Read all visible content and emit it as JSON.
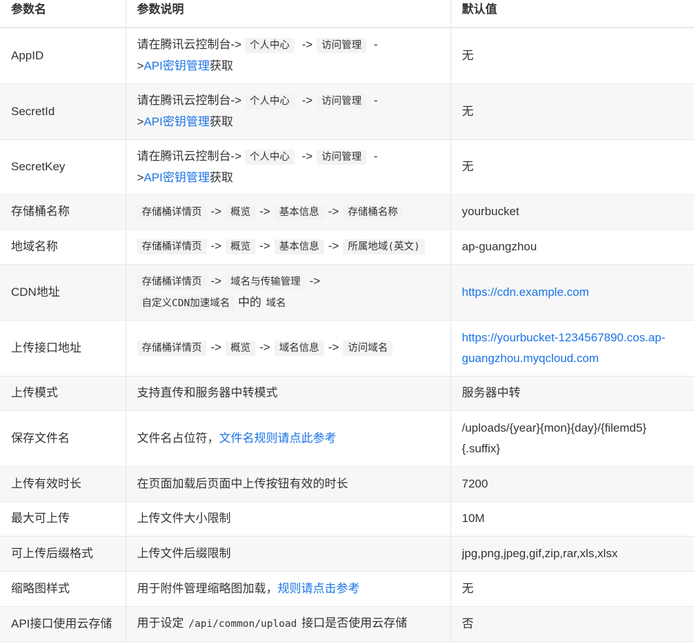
{
  "headers": [
    "参数名",
    "参数说明",
    "默认值"
  ],
  "rows": {
    "appid": {
      "name": "AppID",
      "desc": {
        "prefix": "请在腾讯云控制台->",
        "crumbs": [
          "个人中心",
          "访问管理"
        ],
        "arrow": "->",
        "tail_dash": "-",
        "tail_gt": ">",
        "link": "API密钥管理",
        "suffix": "获取"
      },
      "default": "无"
    },
    "secretid": {
      "name": "SecretId",
      "desc": {
        "prefix": "请在腾讯云控制台->",
        "crumbs": [
          "个人中心",
          "访问管理"
        ],
        "arrow": "->",
        "tail_dash": "-",
        "tail_gt": ">",
        "link": "API密钥管理",
        "suffix": "获取"
      },
      "default": "无"
    },
    "secretkey": {
      "name": "SecretKey",
      "desc": {
        "prefix": "请在腾讯云控制台->",
        "crumbs": [
          "个人中心",
          "访问管理"
        ],
        "arrow": "->",
        "tail_dash": "-",
        "tail_gt": ">",
        "link": "API密钥管理",
        "suffix": "获取"
      },
      "default": "无"
    },
    "bucket": {
      "name": "存储桶名称",
      "desc": {
        "crumbs": [
          "存储桶详情页",
          "概览",
          "基本信息",
          "存储桶名称"
        ],
        "arrow": "->"
      },
      "default": "yourbucket"
    },
    "region": {
      "name": "地域名称",
      "desc": {
        "crumbs": [
          "存储桶详情页",
          "概览",
          "基本信息",
          "所属地域(英文)"
        ],
        "arrow": "->"
      },
      "default": "ap-guangzhou"
    },
    "cdn": {
      "name": "CDN地址",
      "desc": {
        "crumbs": [
          "存储桶详情页",
          "域名与传输管理",
          "自定义CDN加速域名"
        ],
        "arrow": "->",
        "mid": "中的",
        "end": "域名"
      },
      "default": "https://cdn.example.com"
    },
    "upload_url": {
      "name": "上传接口地址",
      "desc": {
        "crumbs": [
          "存储桶详情页",
          "概览",
          "域名信息",
          "访问域名"
        ],
        "arrow": "->"
      },
      "default_line1": "https://yourbucket-1234567890.cos.ap-",
      "default_line2": "guangzhou.myqcloud.com"
    },
    "upload_mode": {
      "name": "上传模式",
      "desc": "支持直传和服务器中转模式",
      "default": "服务器中转"
    },
    "save_name": {
      "name": "保存文件名",
      "desc": {
        "text": "文件名占位符，",
        "link": "文件名规则请点此参考"
      },
      "default_line1": "/uploads/{year}{mon}{day}/{filemd5}",
      "default_line2": "{.suffix}"
    },
    "expire": {
      "name": "上传有效时长",
      "desc": "在页面加载后页面中上传按钮有效的时长",
      "default": "7200"
    },
    "maxsize": {
      "name": "最大可上传",
      "desc": "上传文件大小限制",
      "default": "10M"
    },
    "mimetype": {
      "name": "可上传后缀格式",
      "desc": "上传文件后缀限制",
      "default": "jpg,png,jpeg,gif,zip,rar,xls,xlsx"
    },
    "thumb": {
      "name": "缩略图样式",
      "desc": {
        "text": "用于附件管理缩略图加载，",
        "link": "规则请点击参考"
      },
      "default": "无"
    },
    "api_cloud": {
      "name": "API接口使用云存储",
      "desc": {
        "prefix": "用于设定",
        "code": "/api/common/upload",
        "suffix": "接口是否使用云存储"
      },
      "default": "否"
    }
  }
}
